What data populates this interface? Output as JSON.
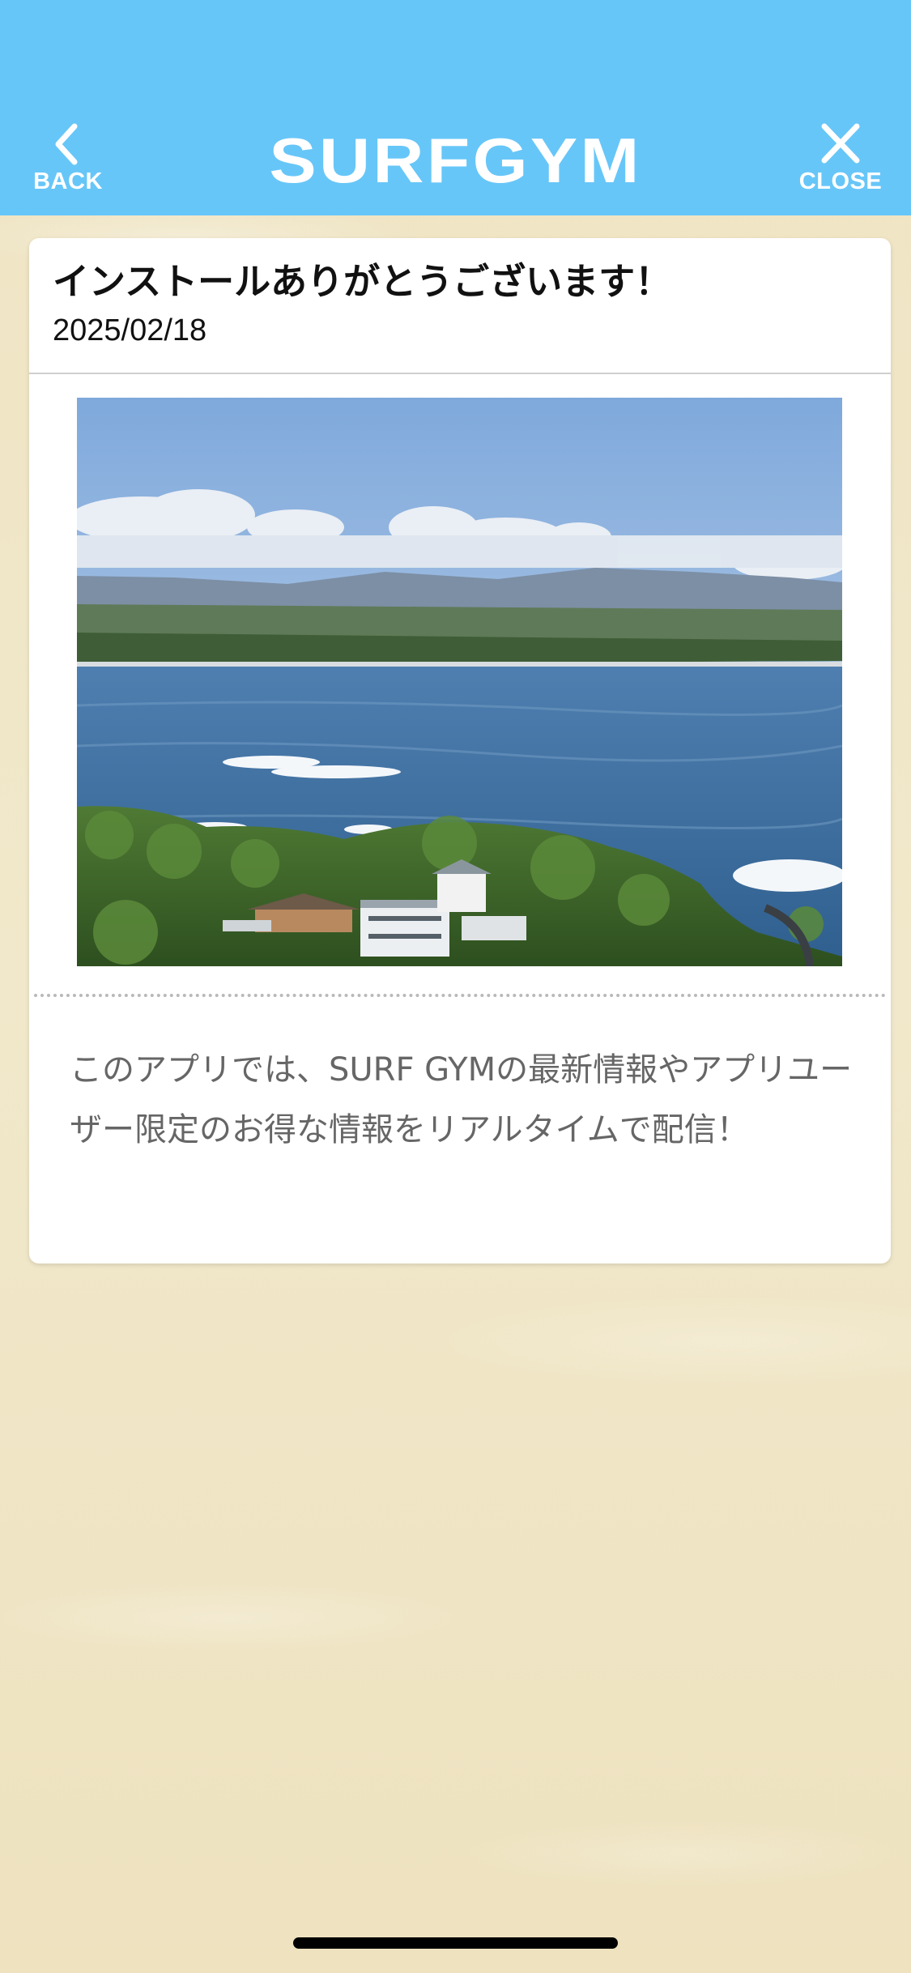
{
  "header": {
    "title": "SURFGYM",
    "back_label": "BACK",
    "close_label": "CLOSE",
    "back_icon": "chevron-left-icon",
    "close_icon": "close-icon",
    "background_color": "#67c6f8"
  },
  "article": {
    "title": "インストールありがとうございます！",
    "date": "2025/02/18",
    "image": "coastal-surf-landscape-photo",
    "body": "このアプリでは、SURF GYMの最新情報やアプリユーザー限定のお得な情報をリアルタイムで配信！"
  }
}
